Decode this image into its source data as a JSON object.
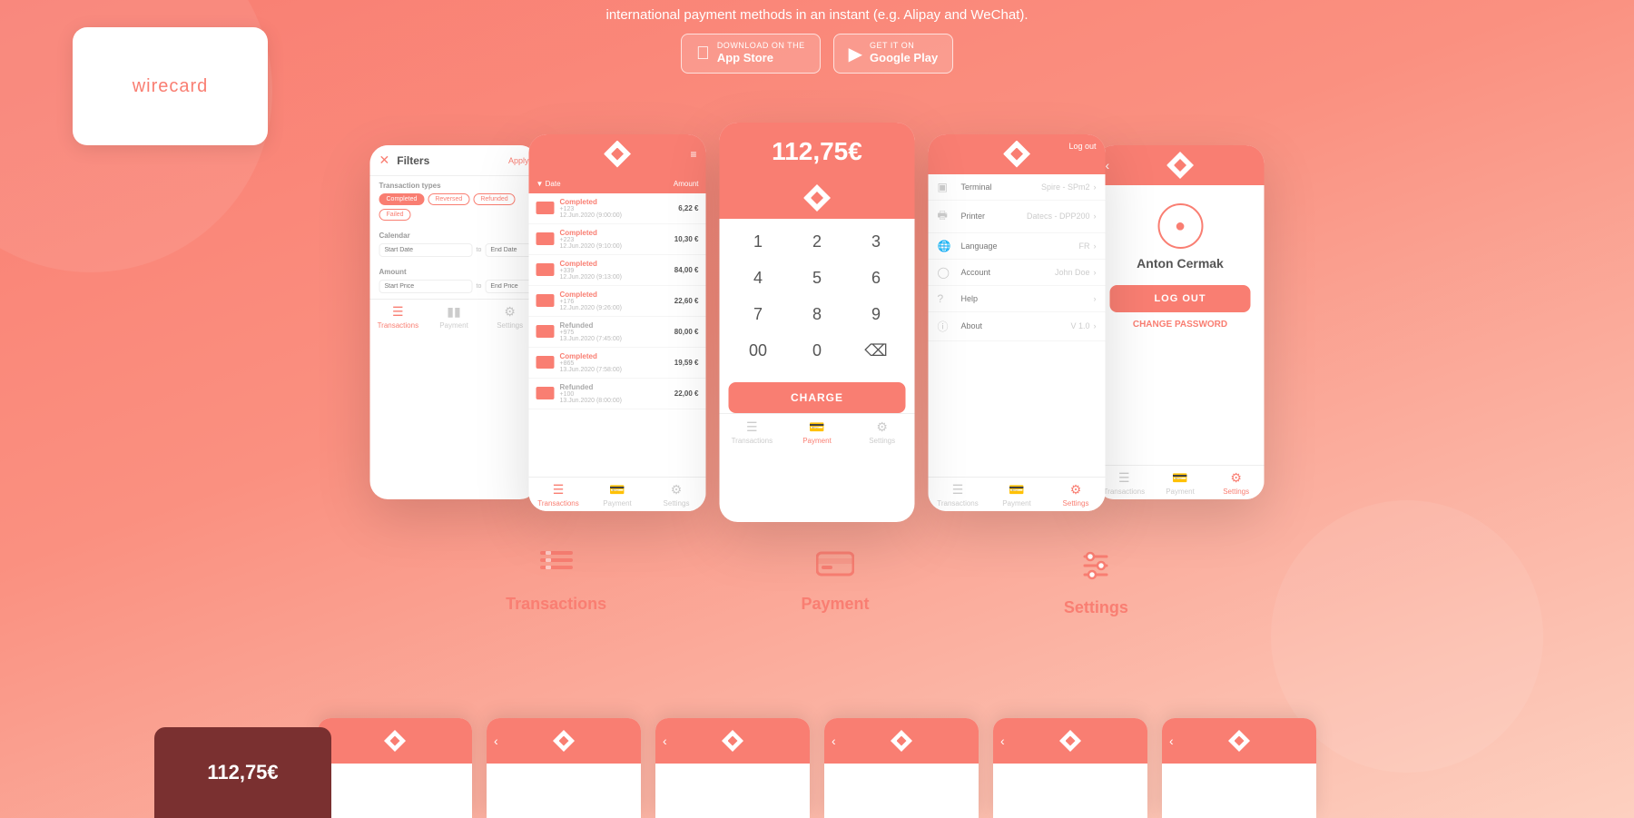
{
  "header": {
    "subtitle": "international payment methods in an instant (e.g. Alipay and WeChat)."
  },
  "store_buttons": {
    "appstore": {
      "small": "Download on the",
      "large": "App Store"
    },
    "googleplay": {
      "small": "GET IT ON",
      "large": "Google Play"
    }
  },
  "wirecard": {
    "logo_text": "wirecard"
  },
  "center_phone": {
    "amount": "112,75€",
    "charge_btn": "CHARGE",
    "nav": {
      "transactions": "Transactions",
      "payment": "Payment",
      "settings": "Settings"
    }
  },
  "transactions": [
    {
      "status": "Completed",
      "id": "+123",
      "date": "12.Jun.2020 (9:00:00)",
      "amount": "6,22 €"
    },
    {
      "status": "Completed",
      "id": "+223",
      "date": "12.Jun.2020 (9:10:00)",
      "amount": "10,30 €"
    },
    {
      "status": "Completed",
      "id": "+339",
      "date": "12.Jun.2020 (9:13:00)",
      "amount": "84,00 €"
    },
    {
      "status": "Completed",
      "id": "+176",
      "date": "12.Jun.2020 (9:26:00)",
      "amount": "22,60 €"
    },
    {
      "status": "Refunded",
      "id": "+975",
      "date": "13.Jun.2020 (7:45:00)",
      "amount": "80,00 €"
    },
    {
      "status": "Completed",
      "id": "+865",
      "date": "13.Jun.2020 (7:58:00)",
      "amount": "19,59 €"
    },
    {
      "status": "Refunded",
      "id": "+100",
      "date": "13.Jun.2020 (8:00:00)",
      "amount": "22,00 €"
    }
  ],
  "filters": {
    "title": "Filters",
    "apply": "Apply",
    "types_title": "Transaction types",
    "chips": [
      "Completed",
      "Reversed",
      "Refunded",
      "Failed"
    ],
    "calendar_title": "Calendar",
    "start_date": "Start Date",
    "end_date": "End Date",
    "amount_title": "Amount",
    "start_price": "Start Price",
    "end_price": "End Price"
  },
  "settings": {
    "items": [
      {
        "label": "Terminal",
        "value": "Spire - SPm2"
      },
      {
        "label": "Printer",
        "value": "Datecs - DPP200"
      },
      {
        "label": "Language",
        "value": "FR"
      },
      {
        "label": "Account",
        "value": "John Doe"
      },
      {
        "label": "Help",
        "value": ""
      },
      {
        "label": "About",
        "value": "V 1.0"
      }
    ]
  },
  "user_screen": {
    "name": "Anton Cermak",
    "logout_btn": "LOG OUT",
    "change_pw_btn": "CHANGE PASSWORD"
  },
  "features": {
    "transactions": "Transactions",
    "payment": "Payment",
    "settings": "Settings"
  },
  "bottom_amount": "112,75€",
  "bottom_phones_count": 6
}
